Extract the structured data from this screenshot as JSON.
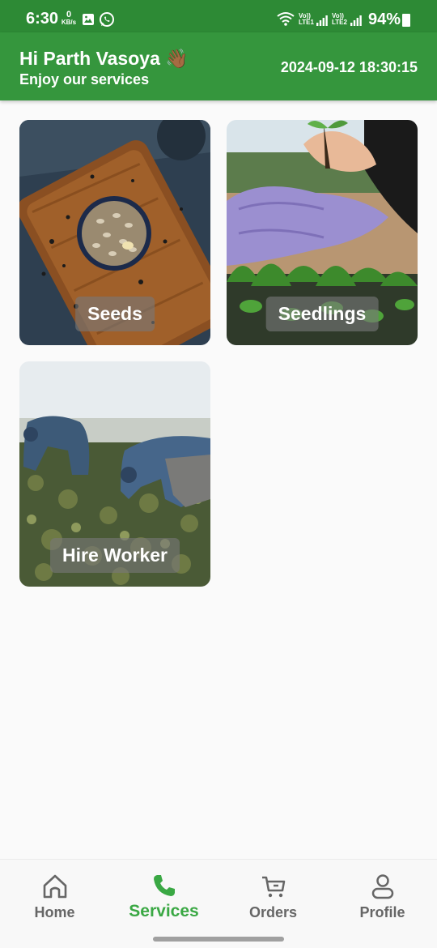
{
  "status_bar": {
    "time": "6:30",
    "net_speed_value": "0",
    "net_speed_unit": "KB/s",
    "sim1_label_top": "Vo))",
    "sim1_label_bottom": "LTE1",
    "sim2_label_top": "Vo))",
    "sim2_label_bottom": "LTE2",
    "battery": "94%",
    "icons": [
      "gallery-icon",
      "whatsapp-icon",
      "wifi-icon",
      "signal-icon",
      "battery-icon"
    ]
  },
  "header": {
    "greeting": "Hi Parth Vasoya 👋🏾",
    "subtitle": "Enjoy our services",
    "datetime": "2024-09-12 18:30:15"
  },
  "services": [
    {
      "label": "Seeds"
    },
    {
      "label": "Seedlings"
    },
    {
      "label": "Hire Worker"
    }
  ],
  "bottom_nav": {
    "items": [
      {
        "label": "Home",
        "icon": "home-icon"
      },
      {
        "label": "Services",
        "icon": "phone-icon"
      },
      {
        "label": "Orders",
        "icon": "cart-icon"
      },
      {
        "label": "Profile",
        "icon": "person-icon"
      }
    ],
    "active": "Services"
  },
  "colors": {
    "status_bar": "#2d8a35",
    "header": "#35963d",
    "accent": "#3aa844",
    "inactive": "#666666"
  }
}
